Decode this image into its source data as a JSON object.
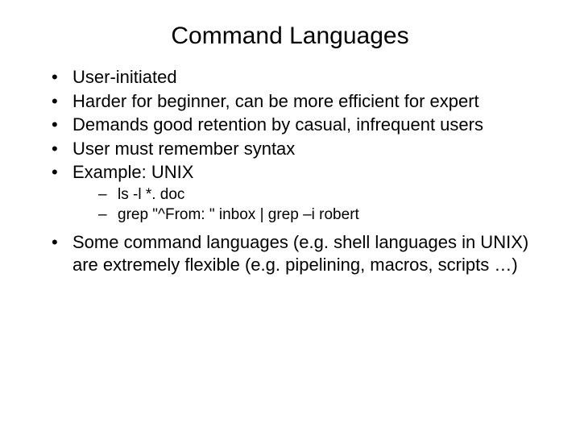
{
  "title": "Command Languages",
  "bullets": {
    "b0": "User-initiated",
    "b1": "Harder for beginner, can be more efficient for expert",
    "b2": "Demands good retention by casual, infrequent users",
    "b3": "User must remember syntax",
    "b4": "Example: UNIX",
    "b5": "Some command languages (e.g. shell languages in UNIX) are extremely flexible (e.g. pipelining, macros, scripts …)"
  },
  "subbullets": {
    "s0": "ls  -l  *. doc",
    "s1": "grep \"^From: \" inbox | grep –i robert"
  }
}
